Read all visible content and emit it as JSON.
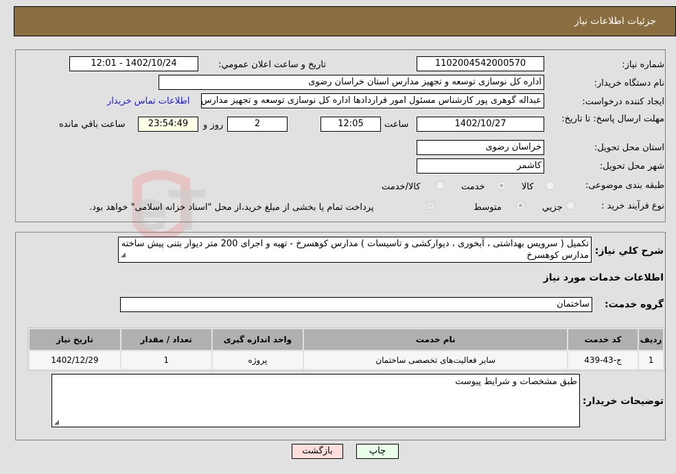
{
  "header": {
    "title": "جزئيات اطلاعات نياز"
  },
  "fields": {
    "need_number": {
      "label": "شماره نياز:",
      "value": "1102004542000570"
    },
    "announce_datetime": {
      "label": "تاريخ و ساعت اعلان عمومي:",
      "value": "1402/10/24 - 12:01"
    },
    "buyer_org": {
      "label": "نام دستگاه خريدار:",
      "value": "اداره کل نوسازی  توسعه و تجهیز مدارس استان خراسان رضوی"
    },
    "requester": {
      "label": "ايجاد کننده درخواست:",
      "value": "عبداله گوهری پور کارشناس مسئول امور قراردادها  اداره کل نوسازی  توسعه و تجهیز مدارس استان خراسان رضوی"
    },
    "buyer_contact_link": "اطلاعات تماس خريدار",
    "deadline": {
      "label": "مهلت ارسال پاسخ: تا تاريخ:",
      "date": "1402/10/27",
      "time_label": "ساعت",
      "time": "12:05",
      "days": "2",
      "days_label": "روز و",
      "remaining": "23:54:49",
      "remaining_label": "ساعت باقي مانده"
    },
    "province": {
      "label": "استان محل تحويل:",
      "value": "خراسان رضوی"
    },
    "city": {
      "label": "شهر محل تحويل:",
      "value": "کاشمر"
    },
    "category": {
      "label": "طبقه بندی موضوعی:",
      "options": [
        "کالا",
        "خدمت",
        "کالا/خدمت"
      ],
      "selected": "خدمت"
    },
    "purchase_type": {
      "label": "نوع فرآيند خريد :",
      "options": [
        "جزيي",
        "متوسط"
      ],
      "selected": "متوسط",
      "treasury_note": "پرداخت تمام يا بخشی از مبلغ خريد،از محل \"اسناد خزانه اسلامی\" خواهد بود."
    }
  },
  "description": {
    "label": "شرح کلي نياز:",
    "value": "تکمیل ( سرویس بهداشتی ، آبخوری ، دیوارکشی و تاسیسات ) مدارس کوهسرخ - تهیه و اجرای 200 متر دیوار بتنی پیش ساخته مدارس کوهسرخ"
  },
  "services": {
    "section_title": "اطلاعات خدمات مورد نياز",
    "group_label": "گروه خدمت:",
    "group_value": "ساختمان",
    "columns": [
      "رديف",
      "کد خدمت",
      "نام خدمت",
      "واحد اندازه گيری",
      "تعداد / مقدار",
      "تاريخ نياز"
    ],
    "rows": [
      [
        "1",
        "ج-43-439",
        "ساير فعاليت‌های تخصصی ساختمان",
        "پروژه",
        "1",
        "1402/12/29"
      ]
    ]
  },
  "buyer_notes": {
    "label": "توضيحات خريدار:",
    "value": "طبق مشخصات و شرايط پيوست"
  },
  "buttons": {
    "print": "چاپ",
    "back": "بازگشت"
  },
  "watermark": "AriaTender.neT",
  "colors": {
    "header_bg": "#8b6d42",
    "print_bg": "#eaffea",
    "back_bg": "#ffdede",
    "link": "#1a1ad6"
  }
}
